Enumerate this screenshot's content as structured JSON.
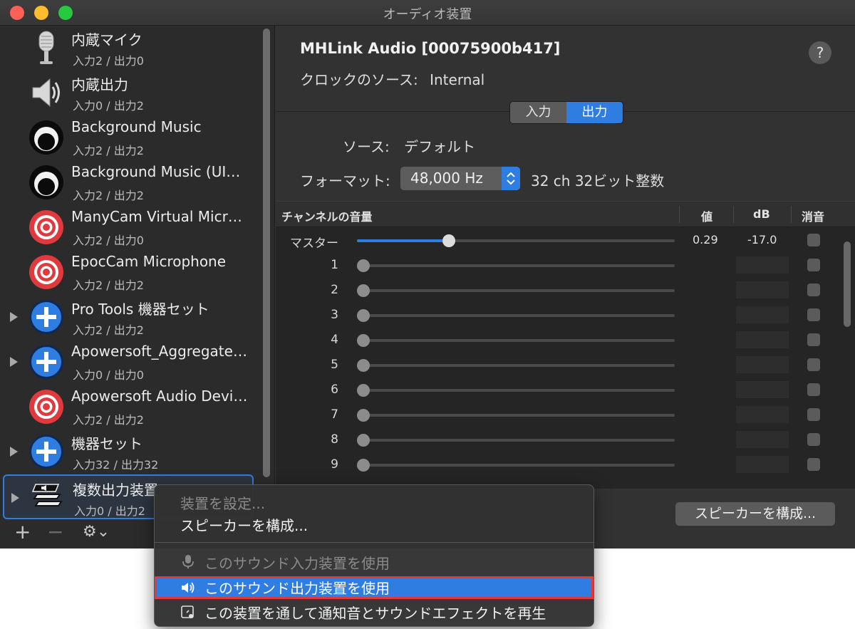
{
  "window": {
    "title": "オーディオ装置"
  },
  "devices": [
    {
      "name": "内蔵マイク",
      "io": "入力2 / 出力0",
      "icon": "microphone-icon",
      "expandable": false
    },
    {
      "name": "内蔵出力",
      "io": "入力0 / 出力2",
      "icon": "speaker-icon",
      "expandable": false
    },
    {
      "name": "Background Music",
      "io": "入力2 / 出力2",
      "icon": "background-music-icon",
      "expandable": false
    },
    {
      "name": "Background Music (UI…",
      "io": "入力2 / 出力2",
      "icon": "background-music-icon",
      "expandable": false
    },
    {
      "name": "ManyCam Virtual Micr…",
      "io": "入力2 / 出力0",
      "icon": "target-icon",
      "expandable": false
    },
    {
      "name": "EpocCam Microphone",
      "io": "入力2 / 出力2",
      "icon": "target-icon",
      "expandable": false
    },
    {
      "name": "Pro Tools 機器セット",
      "io": "入力2 / 出力2",
      "icon": "plus-icon",
      "expandable": true
    },
    {
      "name": "Apowersoft_Aggregate…",
      "io": "入力0 / 出力0",
      "icon": "plus-icon",
      "expandable": true
    },
    {
      "name": "Apowersoft Audio Devi…",
      "io": "入力2 / 出力2",
      "icon": "target-icon",
      "expandable": false
    },
    {
      "name": "機器セット",
      "io": "入力32 / 出力32",
      "icon": "plus-icon",
      "expandable": true
    },
    {
      "name": "複数出力装置",
      "io": "入力0 / 出力2",
      "icon": "multi-output-icon",
      "expandable": true,
      "selected": true
    }
  ],
  "sidebar_toolbar": {
    "add": "+",
    "remove": "−",
    "gear": "⚙︎⌄"
  },
  "detail": {
    "device_title": "MHLink Audio [00075900b417]",
    "clock_label": "クロックのソース:",
    "clock_value": "Internal",
    "help": "?",
    "tabs": [
      "入力",
      "出力"
    ],
    "active_tab": "出力",
    "source_label": "ソース:",
    "source_value": "デフォルト",
    "format_label": "フォーマット:",
    "format_value": "48,000 Hz",
    "format_desc": "32 ch 32ビット整数",
    "table": {
      "headers": {
        "channel": "チャンネルの音量",
        "value": "値",
        "db": "dB",
        "mute": "消音"
      },
      "master": {
        "label": "マスター",
        "level": 0.29,
        "value": "0.29",
        "db": "-17.0"
      },
      "channels": [
        "1",
        "2",
        "3",
        "4",
        "5",
        "6",
        "7",
        "8",
        "9"
      ]
    },
    "configure_speakers_button": "スピーカーを構成..."
  },
  "context_menu": {
    "items": [
      {
        "label": "装置を設定...",
        "disabled": true
      },
      {
        "label": "スピーカーを構成...",
        "disabled": false
      },
      {
        "label": "このサウンド入力装置を使用",
        "disabled": true,
        "icon": "microphone-icon"
      },
      {
        "label": "このサウンド出力装置を使用",
        "disabled": false,
        "icon": "speaker-icon",
        "highlighted": true
      },
      {
        "label": "この装置を通して通知音とサウンドエフェクトを再生",
        "disabled": false,
        "icon": "alert-sound-icon"
      }
    ]
  },
  "colors": {
    "accent": "#2f7de1",
    "highlight_border": "#e23a3a",
    "red_target": "#e0393e"
  }
}
